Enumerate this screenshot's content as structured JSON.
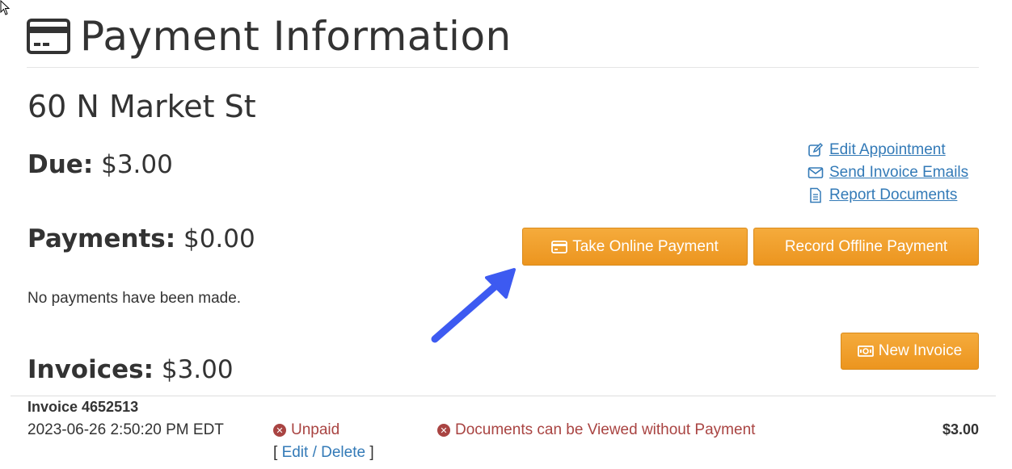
{
  "page": {
    "title": "Payment Information",
    "title_icon": "credit-card-icon"
  },
  "property": {
    "address": "60 N Market St"
  },
  "summary": {
    "due_label": "Due:",
    "due_value": "$3.00",
    "payments_label": "Payments:",
    "payments_value": "$0.00",
    "no_payments_text": "No payments have been made.",
    "invoices_label": "Invoices:",
    "invoices_value": "$3.00"
  },
  "links": [
    {
      "label": "Edit Appointment",
      "icon": "edit-icon"
    },
    {
      "label": "Send Invoice Emails",
      "icon": "envelope-icon"
    },
    {
      "label": "Report Documents",
      "icon": "document-icon"
    }
  ],
  "buttons": {
    "take_online_payment": "Take Online Payment",
    "record_offline_payment": "Record Offline Payment",
    "new_invoice": "New Invoice"
  },
  "invoice": {
    "title": "Invoice 4652513",
    "date": "2023-06-26 2:50:20 PM EDT",
    "status": "Unpaid",
    "documents_status": "Documents can be Viewed without Payment",
    "amount": "$3.00",
    "edit_delete": "Edit / Delete",
    "bracket_open": "[",
    "bracket_close": "]"
  },
  "colors": {
    "button_orange": "#f0a230",
    "link_blue": "#337ab7",
    "error_red": "#a94442",
    "arrow_blue": "#3d5af1"
  }
}
